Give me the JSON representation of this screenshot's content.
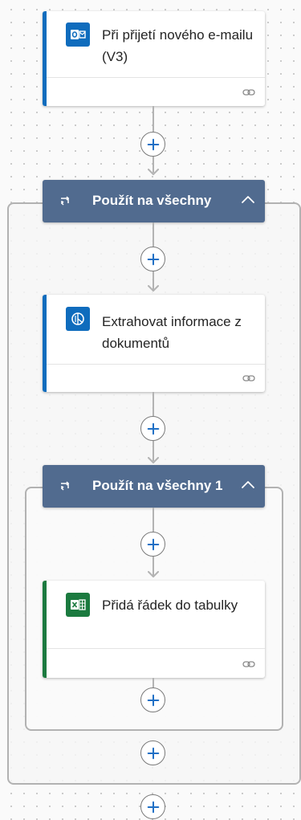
{
  "trigger": {
    "title": "Při přijetí nového e-mailu (V3)",
    "icon": "outlook-icon",
    "accent": "#0f6cbd"
  },
  "scope1": {
    "label": "Použít na všechny",
    "header_color": "#516b8f"
  },
  "action_extract": {
    "title": "Extrahovat informace z dokumentů",
    "icon": "ai-builder-icon",
    "accent": "#0f6cbd"
  },
  "scope2": {
    "label": "Použít na všechny 1",
    "header_color": "#516b8f"
  },
  "action_excel": {
    "title": "Přidá řádek do tabulky",
    "icon": "excel-icon",
    "accent": "#1b7a3f"
  }
}
